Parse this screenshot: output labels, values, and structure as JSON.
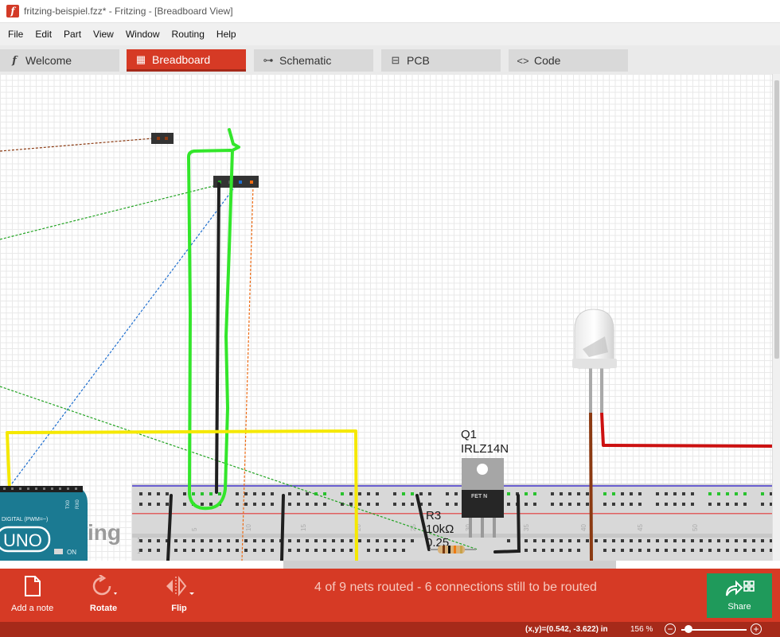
{
  "window": {
    "title": "fritzing-beispiel.fzz* - Fritzing - [Breadboard View]",
    "app_icon": "f"
  },
  "menu": [
    "File",
    "Edit",
    "Part",
    "View",
    "Window",
    "Routing",
    "Help"
  ],
  "tabs": [
    {
      "label": "Welcome",
      "icon": "fritzing-f-icon",
      "glyph": "f"
    },
    {
      "label": "Breadboard",
      "icon": "breadboard-icon",
      "glyph": "▦",
      "active": true
    },
    {
      "label": "Schematic",
      "icon": "resistor-icon",
      "glyph": "⊶"
    },
    {
      "label": "PCB",
      "icon": "pcb-icon",
      "glyph": "⊟"
    },
    {
      "label": "Code",
      "icon": "code-icon",
      "glyph": "<>"
    }
  ],
  "canvas": {
    "q1_ref": "Q1",
    "q1_part": "IRLZ14N",
    "q1_body_text": "FET N",
    "r3_ref": "R3",
    "r3_value": "10kΩ",
    "r3_power": "0.25",
    "arduino_board": "UNO",
    "arduino_label": "DIGITAL (PWM=~)",
    "arduino_tx": "TX0",
    "arduino_rx": "RX0",
    "arduino_on": "ON",
    "fritzing_watermark": "ing",
    "breadboard_numbers": [
      "5",
      "10",
      "15",
      "20",
      "25",
      "30",
      "35",
      "40",
      "45",
      "50"
    ],
    "row_numbers_left": [
      "1",
      "1"
    ],
    "colors": {
      "wire_green": "#33e62b",
      "wire_black": "#1f1f1f",
      "wire_yellow": "#f5e800",
      "wire_red": "#cc1111",
      "wire_brown": "#8b3a12",
      "breadboard": "#d8d8d8",
      "arduino": "#1b7a92"
    }
  },
  "toolbar": {
    "add_note": "Add a note",
    "rotate": "Rotate",
    "flip": "Flip",
    "status_message": "4 of 9 nets routed - 6 connections still to be routed",
    "share": "Share"
  },
  "statusbar": {
    "coordinates": "(x,y)=(0.542, -3.622) in",
    "zoom": "156 %",
    "zoom_level": 0.05
  }
}
